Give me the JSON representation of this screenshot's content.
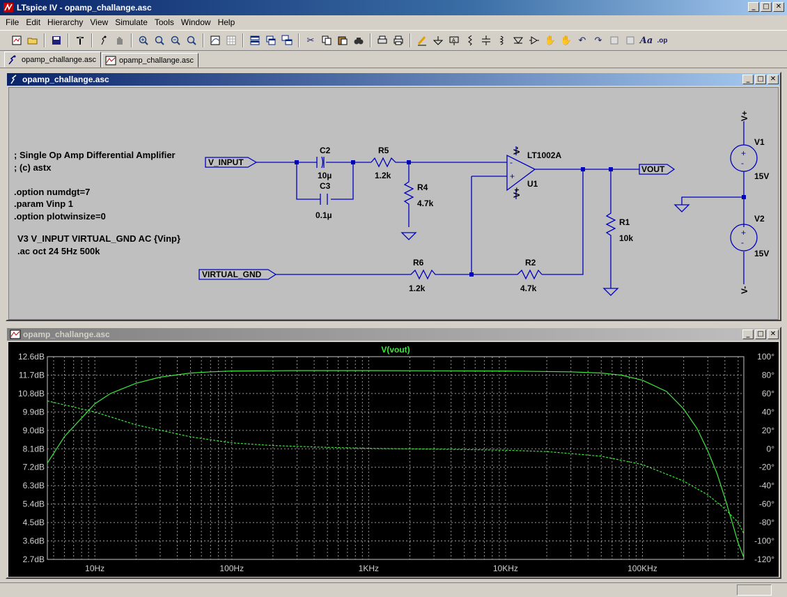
{
  "app": {
    "title": "LTspice IV - opamp_challange.asc",
    "menu": [
      "File",
      "Edit",
      "Hierarchy",
      "View",
      "Simulate",
      "Tools",
      "Window",
      "Help"
    ],
    "tabs": [
      {
        "label": "opamp_challange.asc",
        "icon": "schematic-icon"
      },
      {
        "label": "opamp_challange.asc",
        "icon": "waveform-icon"
      }
    ],
    "toolbar_icons": [
      "new-schematic-icon",
      "open-icon",
      "save-icon",
      "control-panel-icon",
      "run-icon",
      "halt-icon",
      "zoom-in-icon",
      "zoom-out-icon",
      "zoom-to-fit-icon",
      "pan-icon",
      "autorange-icon",
      "grid-icon",
      "tile-horizontal-icon",
      "tile-vertical-icon",
      "cascade-icon",
      "cut-icon",
      "copy-icon",
      "paste-icon",
      "find-icon",
      "print-setup-icon",
      "print-icon",
      "draw-wire-icon",
      "ground-icon",
      "label-net-icon",
      "resistor-icon",
      "capacitor-icon",
      "inductor-icon",
      "diode-icon",
      "component-icon",
      "move-icon",
      "drag-icon",
      "undo-icon",
      "redo-icon",
      "rotate-icon",
      "mirror-icon",
      "text-icon",
      "spice-directive-icon"
    ]
  },
  "schematic": {
    "window_title": "opamp_challange.asc",
    "directives": [
      "; Single Op Amp Differential Amplifier",
      "; (c) astx",
      ".option numdgt=7",
      ".param Vinp 1",
      ".option plotwinsize=0",
      "V3 V_INPUT VIRTUAL_GND AC {Vinp}",
      ".ac oct 24 5Hz 500k"
    ],
    "net_labels": {
      "v_input": "V_INPUT",
      "vout": "VOUT",
      "virtual_gnd": "VIRTUAL_GND"
    },
    "components": {
      "C2": {
        "name": "C2",
        "value": "10µ"
      },
      "C3": {
        "name": "C3",
        "value": "0.1µ"
      },
      "R5": {
        "name": "R5",
        "value": "1.2k"
      },
      "R4": {
        "name": "R4",
        "value": "4.7k"
      },
      "R6": {
        "name": "R6",
        "value": "1.2k"
      },
      "R2": {
        "name": "R2",
        "value": "4.7k"
      },
      "R1": {
        "name": "R1",
        "value": "10k"
      },
      "U1": {
        "name": "U1",
        "model": "LT1002A"
      },
      "V1": {
        "name": "V1",
        "value": "15V"
      },
      "V2": {
        "name": "V2",
        "value": "15V"
      }
    },
    "supply_labels": {
      "vplus": "V+",
      "vminus": "V-",
      "u1_vplus": "V+",
      "u1_vminus": "V-"
    }
  },
  "waveform": {
    "window_title": "opamp_challange.asc",
    "chart_data": {
      "type": "line",
      "title": "V(vout)",
      "x_scale": "log",
      "xlim": [
        4.5,
        550000
      ],
      "x_ticks": [
        {
          "v": 10,
          "label": "10Hz"
        },
        {
          "v": 100,
          "label": "100Hz"
        },
        {
          "v": 1000,
          "label": "1KHz"
        },
        {
          "v": 10000,
          "label": "10KHz"
        },
        {
          "v": 100000,
          "label": "100KHz"
        }
      ],
      "y_left_ticks": [
        "12.6dB",
        "11.7dB",
        "10.8dB",
        "9.9dB",
        "9.0dB",
        "8.1dB",
        "7.2dB",
        "6.3dB",
        "5.4dB",
        "4.5dB",
        "3.6dB",
        "2.7dB"
      ],
      "ylim_left": [
        2.7,
        12.6
      ],
      "y_right_ticks": [
        "100°",
        "80°",
        "60°",
        "40°",
        "20°",
        "0°",
        "-20°",
        "-40°",
        "-60°",
        "-80°",
        "-100°",
        "-120°"
      ],
      "ylim_right": [
        -120,
        100
      ],
      "grid": true,
      "series": [
        {
          "name": "magnitude",
          "axis": "left",
          "style": "solid",
          "color": "#3ee83e",
          "x": [
            4.5,
            6,
            8,
            10,
            13,
            20,
            30,
            50,
            70,
            100,
            300,
            1000,
            10000,
            30000,
            50000,
            70000,
            100000,
            150000,
            200000,
            250000,
            300000,
            350000,
            400000,
            450000,
            500000,
            550000
          ],
          "y": [
            7.4,
            8.7,
            9.6,
            10.3,
            10.8,
            11.3,
            11.6,
            11.8,
            11.86,
            11.9,
            11.92,
            11.92,
            11.9,
            11.86,
            11.8,
            11.7,
            11.45,
            10.9,
            10.05,
            9.1,
            8.0,
            6.9,
            5.7,
            4.55,
            3.5,
            2.8
          ]
        },
        {
          "name": "phase",
          "axis": "right",
          "style": "dashed",
          "color": "#3ee83e",
          "x": [
            4.5,
            10,
            20,
            50,
            100,
            200,
            500,
            1000,
            2000,
            5000,
            10000,
            20000,
            50000,
            100000,
            200000,
            300000,
            400000,
            500000,
            550000
          ],
          "y": [
            52,
            40,
            26,
            13,
            6.5,
            3.5,
            1.6,
            0.5,
            0,
            -0.8,
            -1.5,
            -3,
            -8,
            -17,
            -35,
            -50,
            -65,
            -80,
            -92
          ]
        }
      ]
    }
  }
}
